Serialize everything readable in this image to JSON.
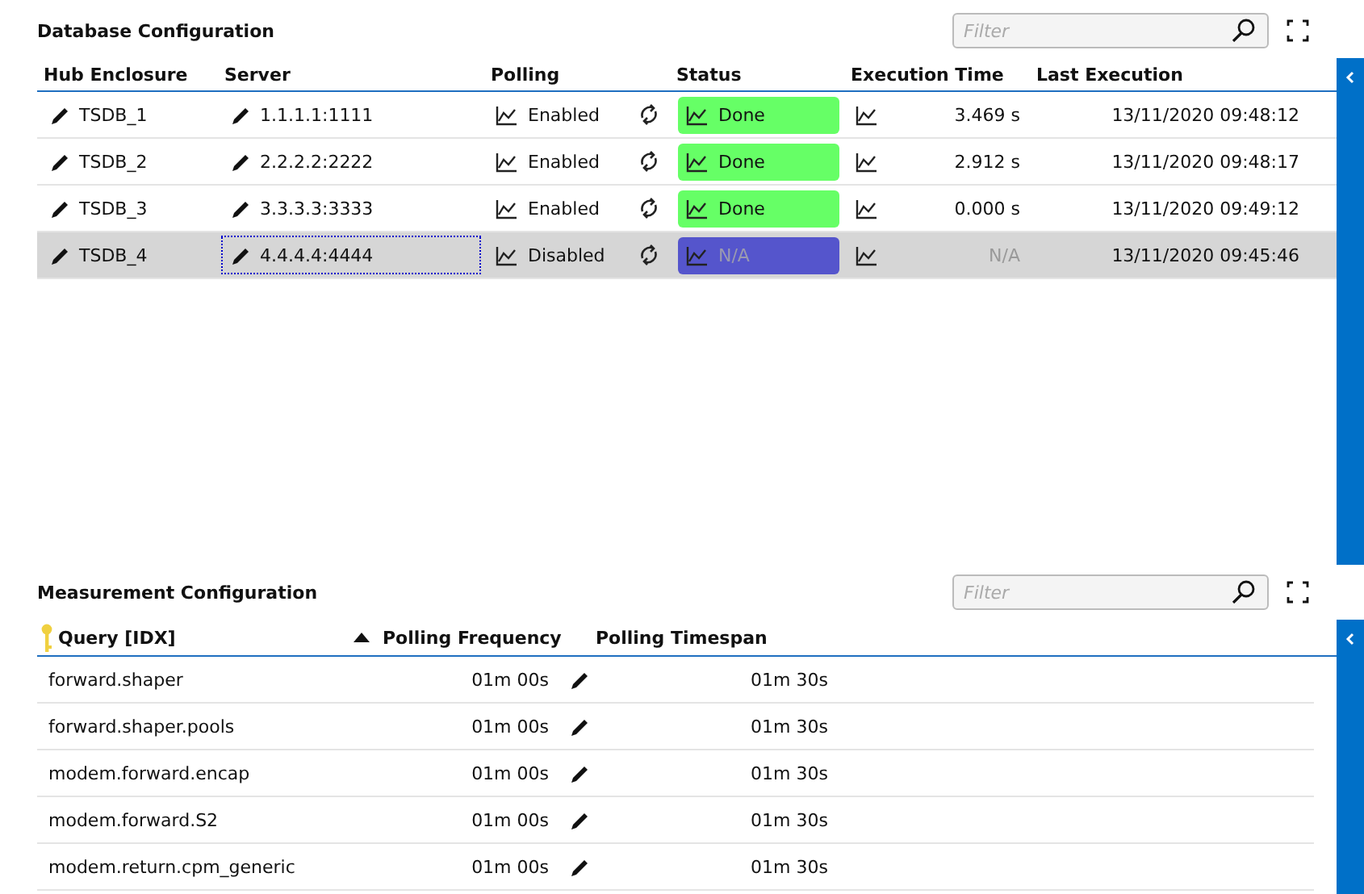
{
  "database_configuration": {
    "title": "Database Configuration",
    "filter": {
      "placeholder": "Filter"
    },
    "columns": [
      "Hub Enclosure",
      "Server",
      "Polling",
      "Status",
      "Execution Time",
      "Last Execution"
    ],
    "rows": [
      {
        "hub": "TSDB_1",
        "server": "1.1.1.1:1111",
        "server_focused": false,
        "polling": "Enabled",
        "status": {
          "label": "Done",
          "color": "#66ff66"
        },
        "execution_time": "3.469 s",
        "inactive": false,
        "last_execution": "13/11/2020 09:48:12",
        "selected": false
      },
      {
        "hub": "TSDB_2",
        "server": "2.2.2.2:2222",
        "server_focused": false,
        "polling": "Enabled",
        "status": {
          "label": "Done",
          "color": "#66ff66"
        },
        "execution_time": "2.912 s",
        "inactive": false,
        "last_execution": "13/11/2020 09:48:17",
        "selected": false
      },
      {
        "hub": "TSDB_3",
        "server": "3.3.3.3:3333",
        "server_focused": false,
        "polling": "Enabled",
        "status": {
          "label": "Done",
          "color": "#66ff66"
        },
        "execution_time": "0.000 s",
        "inactive": false,
        "last_execution": "13/11/2020 09:49:12",
        "selected": false
      },
      {
        "hub": "TSDB_4",
        "server": "4.4.4.4:4444",
        "server_focused": true,
        "polling": "Disabled",
        "status": {
          "label": "N/A",
          "color": "#5555cc"
        },
        "execution_time": "N/A",
        "inactive": true,
        "last_execution": "13/11/2020 09:45:46",
        "selected": true
      }
    ]
  },
  "measurement_configuration": {
    "title": "Measurement Configuration",
    "filter": {
      "placeholder": "Filter"
    },
    "columns": [
      {
        "label": "Query [IDX]",
        "key": true,
        "sorted_ascending": false
      },
      {
        "label": "Polling Frequency",
        "key": false,
        "sorted_ascending": true
      },
      {
        "label": "Polling Timespan",
        "key": false,
        "sorted_ascending": false
      }
    ],
    "rows": [
      {
        "query": "forward.shaper",
        "frequency": "01m 00s",
        "timespan": "01m 30s"
      },
      {
        "query": "forward.shaper.pools",
        "frequency": "01m 00s",
        "timespan": "01m 30s"
      },
      {
        "query": "modem.forward.encap",
        "frequency": "01m 00s",
        "timespan": "01m 30s"
      },
      {
        "query": "modem.forward.S2",
        "frequency": "01m 00s",
        "timespan": "01m 30s"
      },
      {
        "query": "modem.return.cpm_generic",
        "frequency": "01m 00s",
        "timespan": "01m 30s"
      }
    ]
  }
}
